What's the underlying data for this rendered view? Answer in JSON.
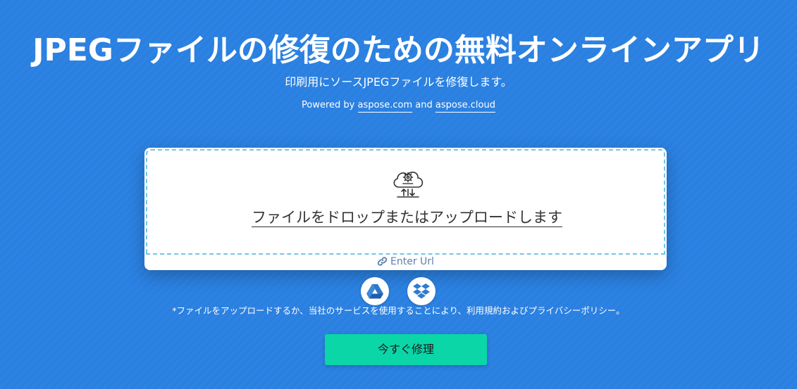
{
  "header": {
    "title": "JPEGファイルの修復のための無料オンラインアプリ",
    "subtitle": "印刷用にソースJPEGファイルを修復します。",
    "powered_prefix": "Powered by",
    "powered_link1": "aspose.com",
    "powered_and": "and",
    "powered_link2": "aspose.cloud"
  },
  "upload": {
    "drop_label": "ファイルをドロップまたはアップロードします",
    "enter_url": "Enter Url",
    "icon": "cloud-gear-icon"
  },
  "services": [
    {
      "name": "google-drive",
      "icon": "google-drive-icon"
    },
    {
      "name": "dropbox",
      "icon": "dropbox-icon"
    }
  ],
  "terms": "*ファイルをアップロードするか、当社のサービスを使用することにより、利用規約およびプライバシーポリシー。",
  "action": {
    "repair_label": "今すぐ修理"
  },
  "colors": {
    "background": "#2b80e0",
    "button": "#0bd6a8",
    "dash_border": "#6fc6e8"
  }
}
